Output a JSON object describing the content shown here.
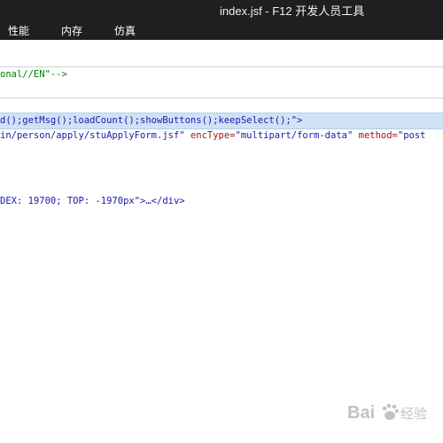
{
  "window": {
    "title": "index.jsf - F12 开发人员工具"
  },
  "tabs": [
    {
      "label": "性能"
    },
    {
      "label": "内存"
    },
    {
      "label": "仿真"
    }
  ],
  "code_lines": {
    "doctype_tail": "onal//EN\"-->",
    "onload_attr": "d();getMsg();loadCount();showButtons();keepSelect();\">",
    "form_action": "in/person/apply/stuApplyForm.jsf\"",
    "enctype_name": "encType=",
    "enctype_value": "\"multipart/form-data\"",
    "method_name": "method=",
    "method_value": "\"post",
    "div_line": "DEX: 19700; TOP: -1970px\">…</div>"
  },
  "colors": {
    "titlebar_bg": "#1f1f1f",
    "selection_bg": "#cfe3f7",
    "comment": "#008000",
    "attr_value": "#1a1aa6",
    "attr_name": "#a31515"
  },
  "watermark": {
    "icon": "baidu-paw-icon",
    "text": "Bai",
    "suffix": "经验"
  }
}
